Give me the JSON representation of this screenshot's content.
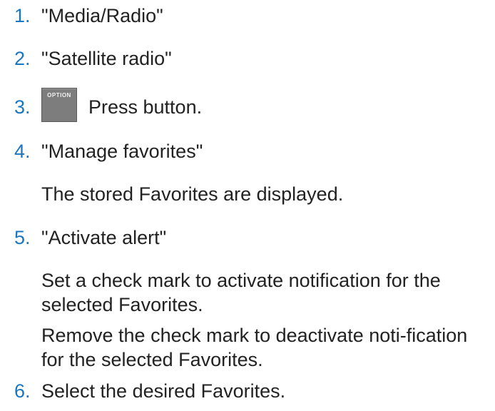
{
  "steps": [
    {
      "number": "1.",
      "text": "\"Media/Radio\""
    },
    {
      "number": "2.",
      "text": "\"Satellite radio\""
    },
    {
      "number": "3.",
      "button_label": "OPTION",
      "text": "Press button."
    },
    {
      "number": "4.",
      "text": "\"Manage favorites\"",
      "notes": [
        "The stored Favorites are displayed."
      ]
    },
    {
      "number": "5.",
      "text": "\"Activate alert\"",
      "notes": [
        "Set a check mark to activate notification for the selected Favorites.",
        "Remove the check mark to deactivate noti-fication for the selected Favorites."
      ]
    },
    {
      "number": "6.",
      "text": "Select the desired Favorites."
    }
  ]
}
